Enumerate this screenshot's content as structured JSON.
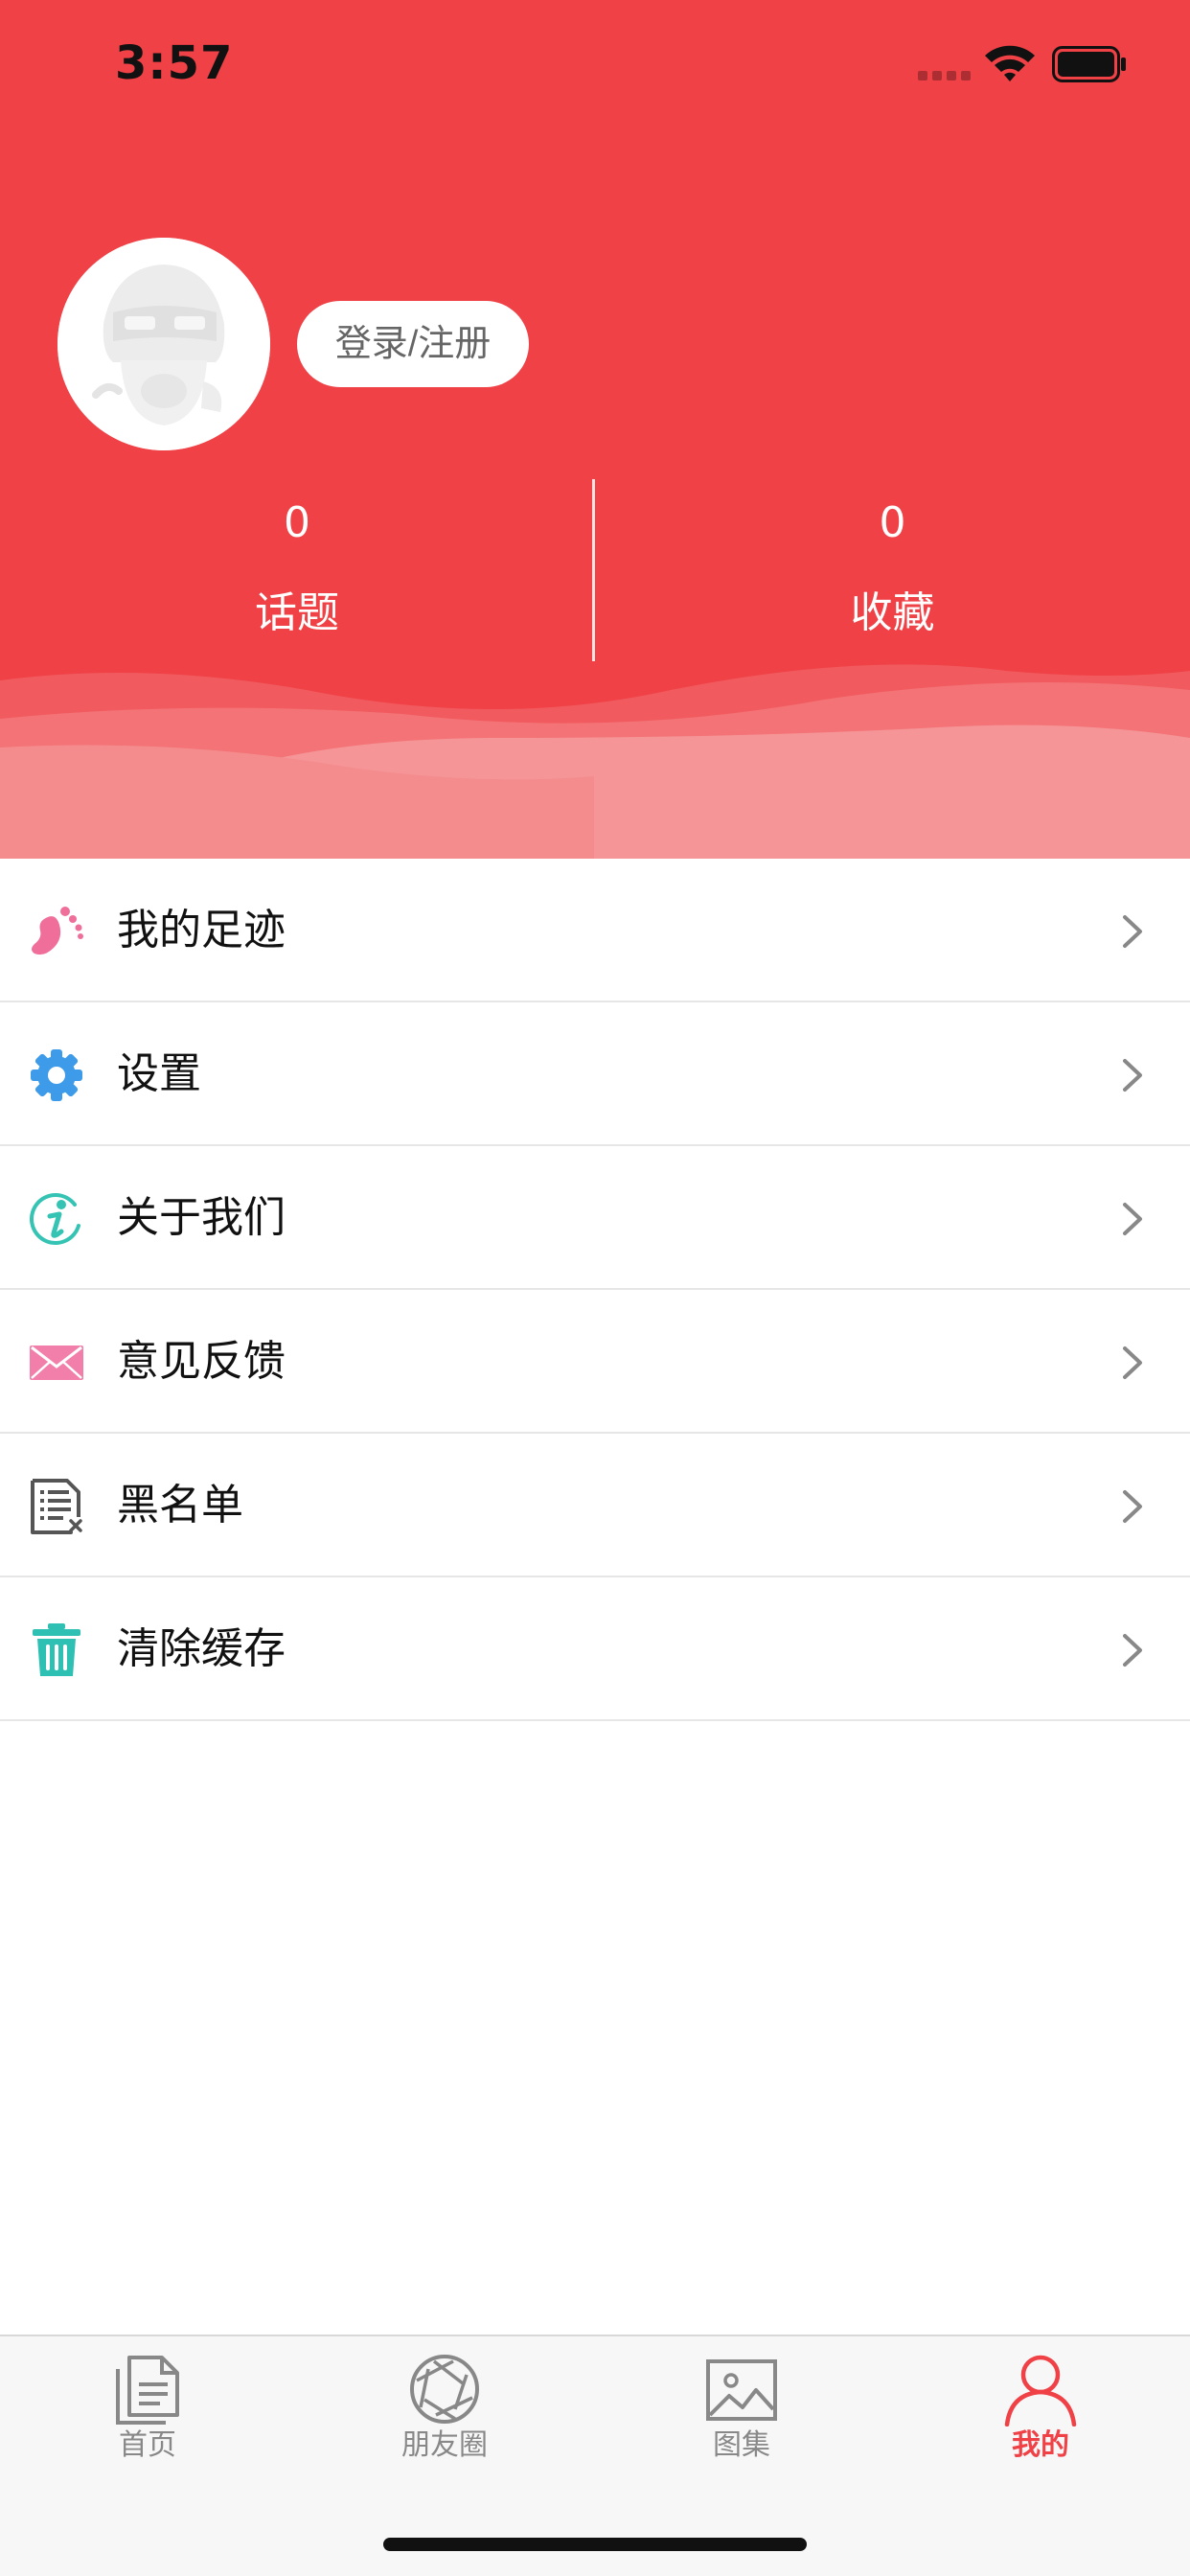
{
  "status_bar": {
    "time": "3:57"
  },
  "profile": {
    "login_label": "登录/注册",
    "stats": [
      {
        "value": "0",
        "label": "话题"
      },
      {
        "value": "0",
        "label": "收藏"
      }
    ]
  },
  "menu": {
    "items": [
      {
        "label": "我的足迹",
        "icon": "footprint-icon"
      },
      {
        "label": "设置",
        "icon": "gear-icon"
      },
      {
        "label": "关于我们",
        "icon": "info-icon"
      },
      {
        "label": "意见反馈",
        "icon": "envelope-icon"
      },
      {
        "label": "黑名单",
        "icon": "blacklist-icon"
      },
      {
        "label": "清除缓存",
        "icon": "trash-icon"
      }
    ]
  },
  "tabbar": {
    "tabs": [
      {
        "label": "首页",
        "icon": "document-icon"
      },
      {
        "label": "朋友圈",
        "icon": "aperture-icon"
      },
      {
        "label": "图集",
        "icon": "image-icon"
      },
      {
        "label": "我的",
        "icon": "person-icon"
      }
    ],
    "active_index": 3
  },
  "colors": {
    "brand": "#EF4146",
    "footprint": "#F06E9A",
    "gear": "#3D9BE9",
    "info": "#35C3B4",
    "envelope": "#F27FAA",
    "blacklist": "#555555",
    "trash": "#2FC0B4"
  }
}
